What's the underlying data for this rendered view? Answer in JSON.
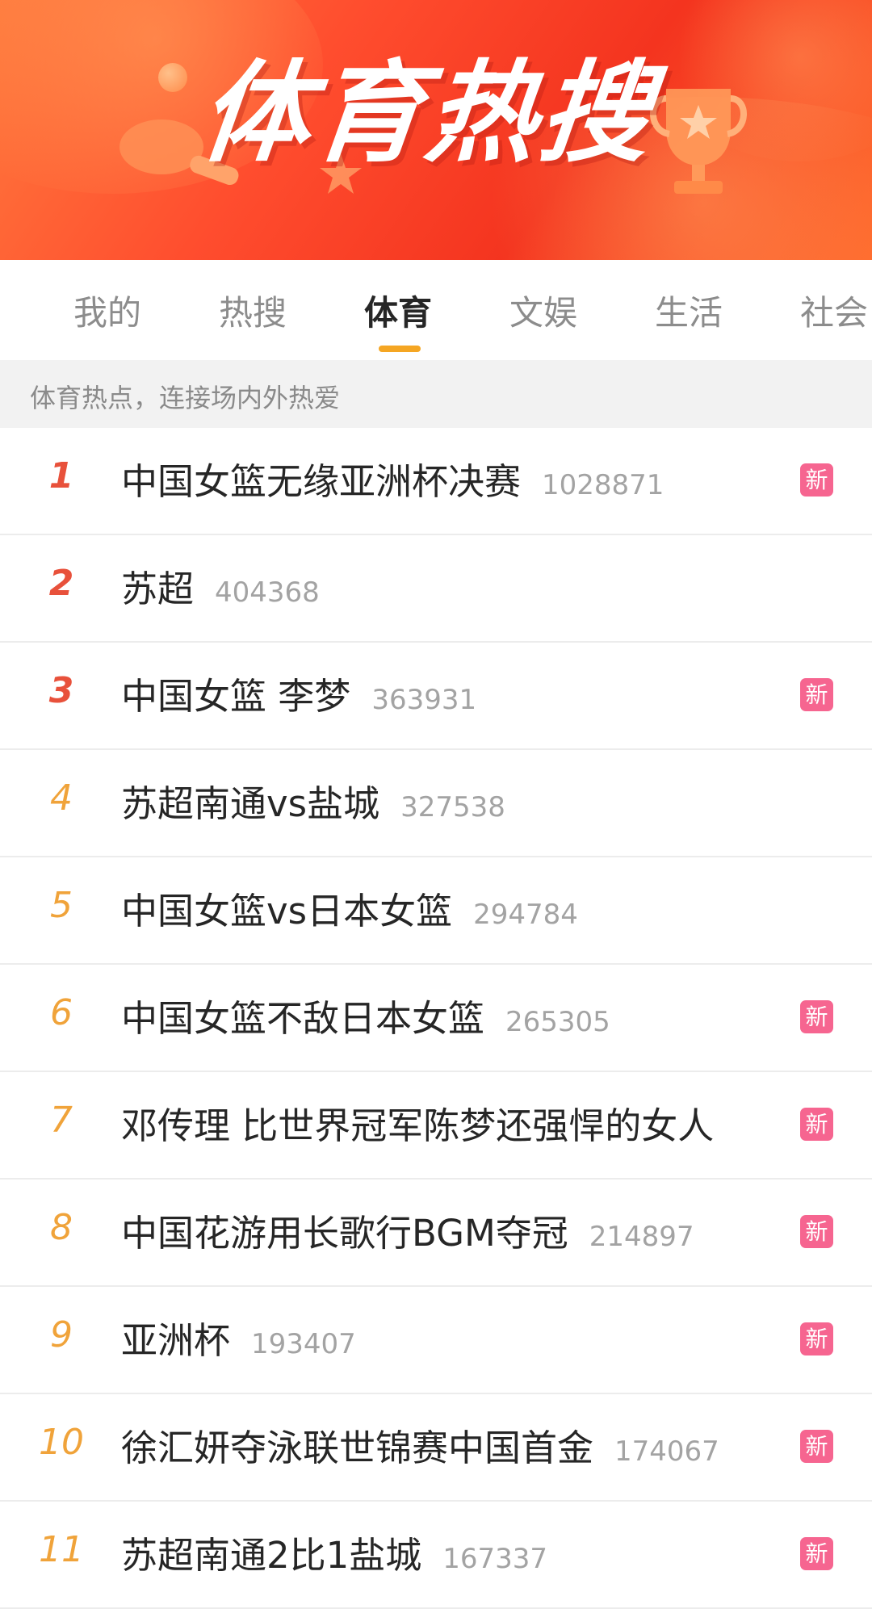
{
  "banner": {
    "title": "体育热搜"
  },
  "tabs": [
    {
      "label": "我的",
      "active": false
    },
    {
      "label": "热搜",
      "active": false
    },
    {
      "label": "体育",
      "active": true
    },
    {
      "label": "文娱",
      "active": false
    },
    {
      "label": "生活",
      "active": false
    },
    {
      "label": "社会",
      "active": false
    }
  ],
  "subheader": {
    "text": "体育热点，连接场内外热爱"
  },
  "list": [
    {
      "rank": "1",
      "title": "中国女篮无缘亚洲杯决赛",
      "count": "1028871",
      "badge": "新"
    },
    {
      "rank": "2",
      "title": "苏超",
      "count": "404368",
      "badge": ""
    },
    {
      "rank": "3",
      "title": "中国女篮 李梦",
      "count": "363931",
      "badge": "新"
    },
    {
      "rank": "4",
      "title": "苏超南通vs盐城",
      "count": "327538",
      "badge": ""
    },
    {
      "rank": "5",
      "title": "中国女篮vs日本女篮",
      "count": "294784",
      "badge": ""
    },
    {
      "rank": "6",
      "title": "中国女篮不敌日本女篮",
      "count": "265305",
      "badge": "新"
    },
    {
      "rank": "7",
      "title": "邓传理 比世界冠军陈梦还强悍的女人",
      "count": "",
      "badge": "新"
    },
    {
      "rank": "8",
      "title": "中国花游用长歌行BGM夺冠",
      "count": "214897",
      "badge": "新"
    },
    {
      "rank": "9",
      "title": "亚洲杯",
      "count": "193407",
      "badge": "新"
    },
    {
      "rank": "10",
      "title": "徐汇妍夺泳联世锦赛中国首金",
      "count": "174067",
      "badge": "新"
    },
    {
      "rank": "11",
      "title": "苏超南通2比1盐城",
      "count": "167337",
      "badge": "新"
    }
  ],
  "colors": {
    "accent_underline": "#f5a623",
    "rank_top": "#e8513b",
    "rank_other": "#f0a33a",
    "badge_new": "#f66590",
    "banner_red": "#f4341f"
  }
}
